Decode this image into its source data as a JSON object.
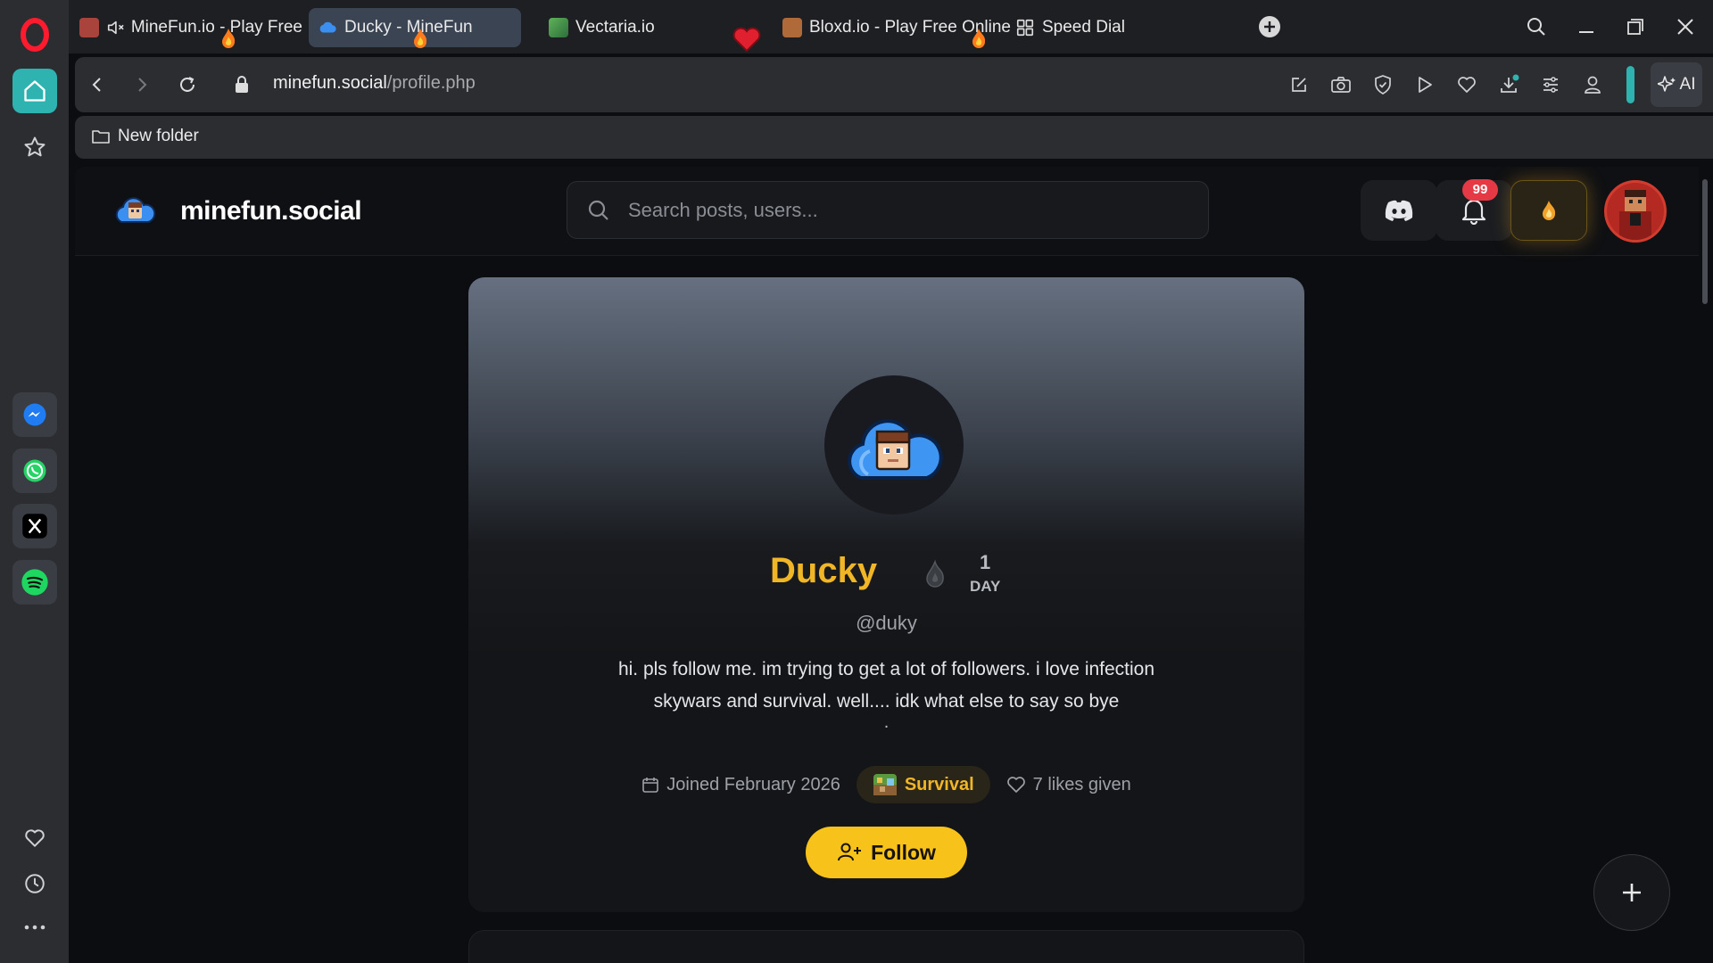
{
  "tabs": [
    {
      "title": "MineFun.io - Play Free",
      "muted": true
    },
    {
      "title": "Ducky - MineFun",
      "active": true
    },
    {
      "title": "Vectaria.io"
    },
    {
      "title": "Bloxd.io - Play Free Online"
    },
    {
      "title": "Speed Dial"
    }
  ],
  "address_bar": {
    "domain": "minefun.social",
    "path": "/profile.php",
    "ai_label": "AI"
  },
  "bookmarks": {
    "folder": "New folder"
  },
  "site": {
    "name": "minefun.social",
    "search_placeholder": "Search posts, users...",
    "notification_count": "99"
  },
  "profile": {
    "display_name": "Ducky",
    "streak_value": "1",
    "streak_unit": "DAY",
    "handle": "@duky",
    "bio": "hi. pls follow me. im trying to get a lot of followers. i love infection skywars and survival. well.... idk what else to say so bye",
    "bio_trailing": ".",
    "joined": "Joined February 2026",
    "game_mode": "Survival",
    "likes_given": "7 likes given",
    "follow_label": "Follow"
  },
  "colors": {
    "accent": "#f0b626",
    "follow_button": "#f7c21a",
    "badge": "#e53945",
    "sidebar_active": "#2fb3b0"
  }
}
